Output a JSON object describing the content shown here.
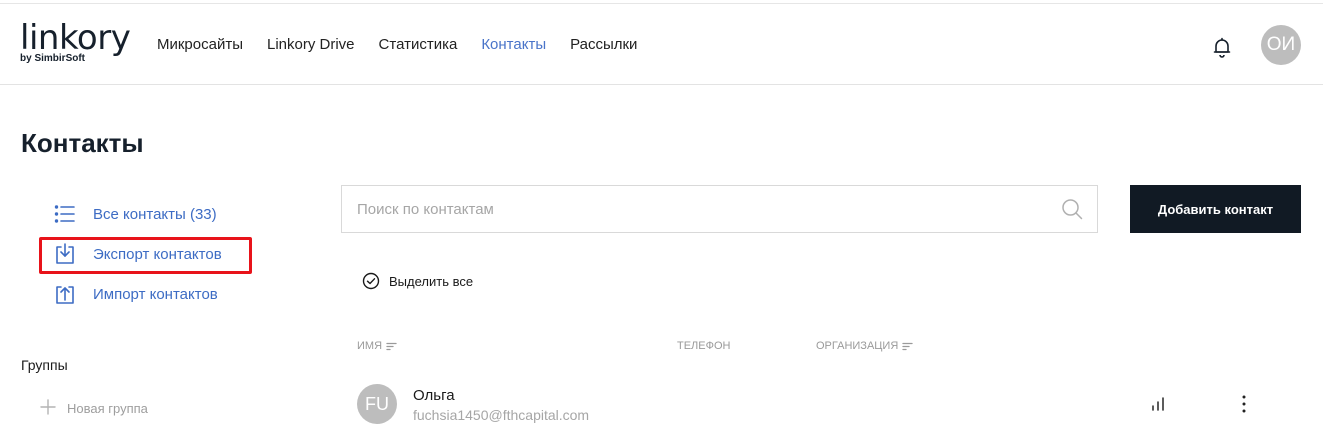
{
  "header": {
    "logo_word": "linkory",
    "logo_sub": "by SimbirSoft",
    "nav": [
      {
        "label": "Микросайты",
        "active": false
      },
      {
        "label": "Linkory Drive",
        "active": false
      },
      {
        "label": "Статистика",
        "active": false
      },
      {
        "label": "Контакты",
        "active": true
      },
      {
        "label": "Рассылки",
        "active": false
      }
    ],
    "bell_icon": "bell-icon",
    "avatar_initials": "ОИ"
  },
  "page": {
    "title": "Контакты"
  },
  "sidebar": {
    "items": [
      {
        "label": "Все контакты (33)",
        "icon": "list-icon"
      },
      {
        "label": "Экспорт контактов",
        "icon": "download-icon",
        "highlighted": true
      },
      {
        "label": "Импорт контактов",
        "icon": "upload-icon"
      }
    ],
    "groups_title": "Группы",
    "new_group_label": "Новая группа"
  },
  "search": {
    "placeholder": "Поиск по контактам",
    "value": ""
  },
  "actions": {
    "add_contact_label": "Добавить контакт",
    "select_all_label": "Выделить все"
  },
  "table": {
    "columns": [
      {
        "label": "Имя",
        "sortable": true
      },
      {
        "label": "Телефон",
        "sortable": false
      },
      {
        "label": "Организация",
        "sortable": true
      }
    ],
    "rows": [
      {
        "initials": "FU",
        "name": "Ольга",
        "email": "fuchsia1450@fthcapital.com"
      }
    ]
  },
  "colors": {
    "accent": "#4a74c9",
    "link": "#3d6cc4",
    "dark_button": "#111a24",
    "highlight_border": "#e8131a",
    "avatar_bg": "#bdbdbd"
  }
}
